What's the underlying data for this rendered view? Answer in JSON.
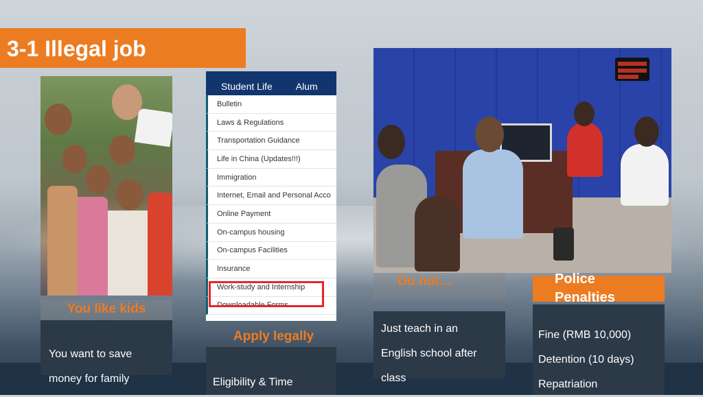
{
  "slide": {
    "title": "3-1 Illegal job"
  },
  "menu": {
    "header_tabs": [
      "Student Life",
      "Alum"
    ],
    "items": [
      "Bulletin",
      "Laws & Regulations",
      "Transportation Guidance",
      "Life in China (Updates!!!)",
      "Immigration",
      "Internet, Email and Personal Acco",
      "Online Payment",
      "On-campus housing",
      "On-campus Facilities",
      "Insurance",
      "Work-study and Internship",
      "Downloadable Forms"
    ],
    "highlighted_item": "Work-study and Internship"
  },
  "columns": {
    "kids": {
      "label": "You like kids",
      "text_line1": "You want to save",
      "text_line2": "money for family"
    },
    "apply": {
      "label": "Apply legally",
      "text": "Eligibility & Time"
    },
    "donot": {
      "label": "Do not…",
      "text_line1": "Just teach in an",
      "text_line2": "English school after",
      "text_line3": "class"
    },
    "penalties": {
      "label_line1": "Police",
      "label_line2": "Penalties",
      "items": [
        "Fine (RMB 10,000)",
        "Detention (10 days)",
        "Repatriation"
      ]
    }
  },
  "colors": {
    "accent": "#ec7c22",
    "highlight": "#e3262a",
    "menu_header": "#12356e",
    "card": "#2c3947"
  }
}
